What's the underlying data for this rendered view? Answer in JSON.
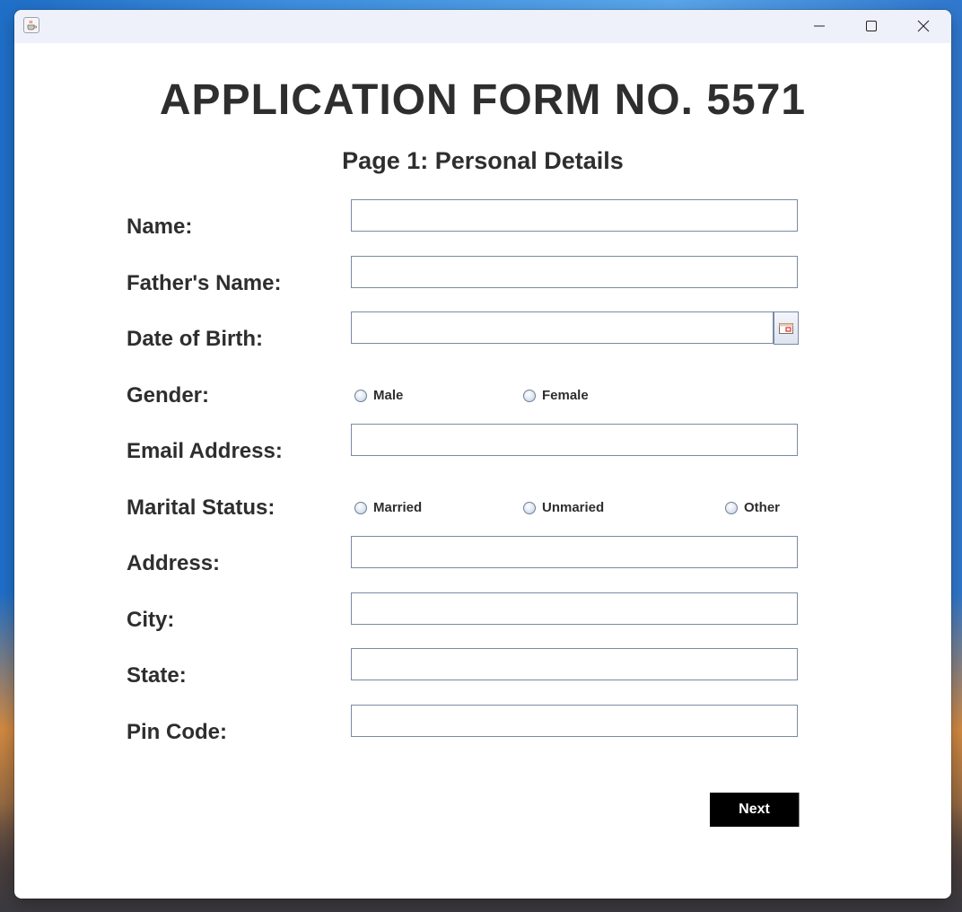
{
  "form": {
    "heading": "APPLICATION FORM NO. 5571",
    "subheading": "Page 1: Personal Details",
    "labels": {
      "name": "Name:",
      "father_name": "Father's Name:",
      "dob": "Date of Birth:",
      "gender": "Gender:",
      "email": "Email Address:",
      "marital": "Marital Status:",
      "address": "Address:",
      "city": "City:",
      "state": "State:",
      "pin": "Pin Code:"
    },
    "values": {
      "name": "",
      "father_name": "",
      "dob": "",
      "email": "",
      "address": "",
      "city": "",
      "state": "",
      "pin": ""
    },
    "gender_options": [
      "Male",
      "Female"
    ],
    "marital_options": [
      "Married",
      "Unmaried",
      "Other"
    ],
    "next_label": "Next"
  },
  "icons": {
    "app": "java-cup-icon",
    "minimize": "minimize-icon",
    "maximize": "maximize-icon",
    "close": "close-icon",
    "calendar": "calendar-icon"
  }
}
